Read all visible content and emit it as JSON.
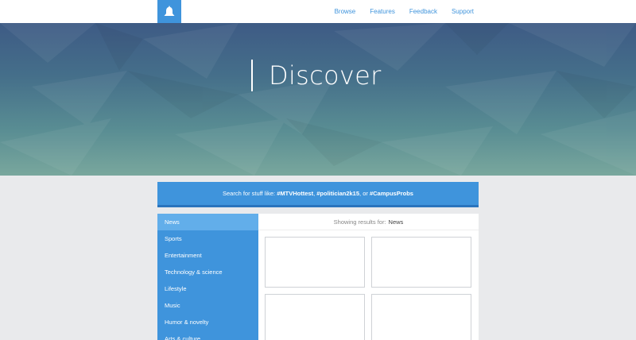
{
  "nav": {
    "logo_icon": "bell-icon",
    "links": [
      "Browse",
      "Features",
      "Feedback",
      "Support"
    ]
  },
  "hero": {
    "title": "Discover"
  },
  "search": {
    "prefix": "Search for stuff like: ",
    "tag1": "#MTVHottest",
    "sep1": ", ",
    "tag2": "#politician2k15",
    "sep2": ", or ",
    "tag3": "#CampusProbs"
  },
  "sidebar": {
    "items": [
      "News",
      "Sports",
      "Entertainment",
      "Technology & science",
      "Lifestyle",
      "Music",
      "Humor & novelty",
      "Arts & culture"
    ],
    "active": "News"
  },
  "main": {
    "results_prefix": "Showing results for:",
    "results_value": "News"
  },
  "colors": {
    "accent": "#3f94dc",
    "accent_active": "#62aeea"
  }
}
